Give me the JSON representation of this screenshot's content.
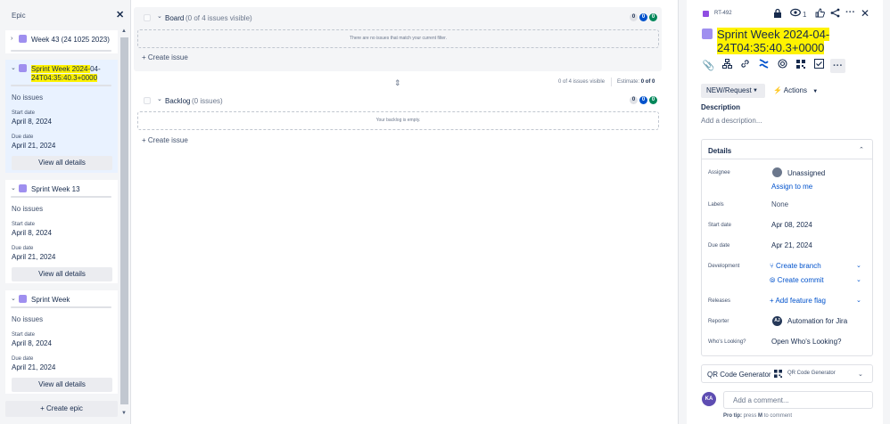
{
  "epic_panel": {
    "title": "Epic",
    "close_icon": "✕",
    "create_epic": "Create epic",
    "epics": [
      {
        "name": "Week 43 (24 1025 2023)",
        "expanded": false
      },
      {
        "name_highlight": "Sprint Week 2024-",
        "name_rest": "04-",
        "name_line2": "24T04:35:40.3+0000",
        "expanded": true,
        "selected": true,
        "no_issues": "No issues",
        "start_label": "Start date",
        "start_value": "April 8, 2024",
        "due_label": "Due date",
        "due_value": "April 21, 2024",
        "view_details": "View all details"
      },
      {
        "name": "Sprint Week 13",
        "expanded": true,
        "no_issues": "No issues",
        "start_label": "Start date",
        "start_value": "April 8, 2024",
        "due_label": "Due date",
        "due_value": "April 21, 2024",
        "view_details": "View all details"
      },
      {
        "name": "Sprint Week",
        "expanded": true,
        "no_issues": "No issues",
        "start_label": "Start date",
        "start_value": "April 8, 2024",
        "due_label": "Due date",
        "due_value": "April 21, 2024",
        "view_details": "View all details"
      }
    ]
  },
  "board": {
    "title": "Board",
    "subtitle": "(0 of 4 issues visible)",
    "counts": [
      "0",
      "0",
      "0"
    ],
    "empty_message": "There are no issues that match your current filter.",
    "create_issue": "Create issue"
  },
  "summary_bar": {
    "issues_visible": "0 of 4 issues visible",
    "estimate_label": "Estimate:",
    "estimate_value": "0 of 0"
  },
  "backlog": {
    "title": "Backlog",
    "subtitle": "(0 issues)",
    "counts": [
      "0",
      "0",
      "0"
    ],
    "empty_message": "Your backlog is empty.",
    "create_issue": "Create issue"
  },
  "issue": {
    "key": "RT-492",
    "watch_count": "1",
    "title_line1": "Sprint Week 2024-04-",
    "title_line2": "24T04:35:40.3+0000",
    "status": "NEW/Request",
    "actions": "Actions",
    "description_label": "Description",
    "description_placeholder": "Add a description...",
    "details": {
      "title": "Details",
      "assignee_label": "Assignee",
      "assignee_value": "Unassigned",
      "assign_to_me": "Assign to me",
      "labels_label": "Labels",
      "labels_value": "None",
      "start_label": "Start date",
      "start_value": "Apr 08, 2024",
      "due_label": "Due date",
      "due_value": "Apr 21, 2024",
      "development_label": "Development",
      "create_branch": "Create branch",
      "create_commit": "Create commit",
      "releases_label": "Releases",
      "add_feature_flag": "Add feature flag",
      "reporter_label": "Reporter",
      "reporter_initials": "AJ",
      "reporter_value": "Automation for Jira",
      "whos_looking_label": "Who's Looking?",
      "whos_looking_value": "Open Who's Looking?"
    },
    "qr": {
      "title": "QR Code Generator",
      "sub": "QR Code Generator"
    },
    "comment": {
      "avatar_initials": "KA",
      "placeholder": "Add a comment...",
      "pro_tip_bold": "Pro tip:",
      "pro_tip_press": "press",
      "pro_tip_key": "M",
      "pro_tip_rest": "to comment"
    }
  },
  "colors": {
    "epic_purple": "#9f8fef",
    "highlight_yellow": "#fef200",
    "link_blue": "#0052cc",
    "count_blue": "#0052cc",
    "count_green": "#00875a"
  }
}
